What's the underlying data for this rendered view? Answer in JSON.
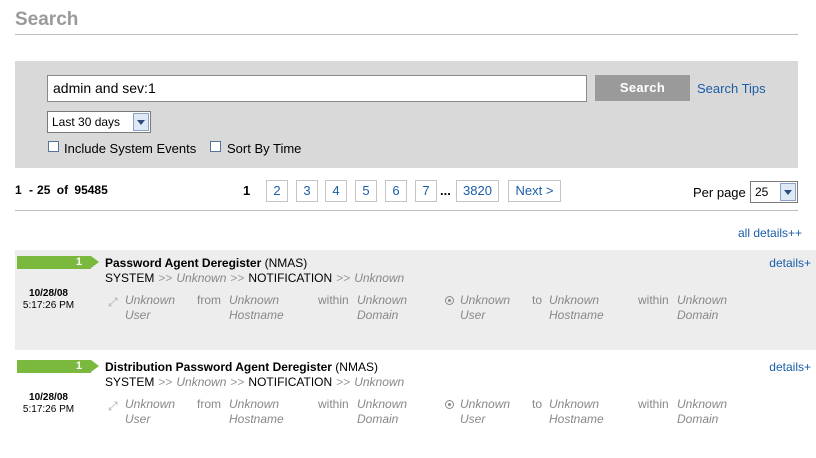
{
  "page_title": "Search",
  "search": {
    "query": "admin and sev:1",
    "button_label": "Search",
    "tips_label": "Search Tips",
    "range_selected": "Last 30 days",
    "include_system_label": "Include System Events",
    "sort_by_time_label": "Sort By Time"
  },
  "results": {
    "range_start": "1",
    "range_end": "25",
    "of_label": "of",
    "total": "95485",
    "dash": "-"
  },
  "pagination": {
    "current": "1",
    "pages": [
      "2",
      "3",
      "4",
      "5",
      "6",
      "7"
    ],
    "ellipsis": "...",
    "last": "3820",
    "next_label": "Next >"
  },
  "per_page": {
    "label": "Per page",
    "value": "25"
  },
  "all_details_label": "all details++",
  "events": [
    {
      "severity": "1",
      "name": "Password Agent Deregister",
      "source": "(NMAS)",
      "details_label": "details+",
      "taxonomy": [
        "SYSTEM",
        "Unknown",
        "NOTIFICATION",
        "Unknown"
      ],
      "sep": ">>",
      "date": "10/28/08",
      "time": "5:17:26 PM",
      "init_user": "Unknown User",
      "from_label": "from",
      "init_host": "Unknown Hostname",
      "within_label": "within",
      "init_domain": "Unknown Domain",
      "target_user": "Unknown User",
      "to_label": "to",
      "target_host": "Unknown Hostname",
      "target_within_label": "within",
      "target_domain": "Unknown Domain"
    },
    {
      "severity": "1",
      "name": "Distribution Password Agent Deregister",
      "source": "(NMAS)",
      "details_label": "details+",
      "taxonomy": [
        "SYSTEM",
        "Unknown",
        "NOTIFICATION",
        "Unknown"
      ],
      "sep": ">>",
      "date": "10/28/08",
      "time": "5:17:26 PM",
      "init_user": "Unknown User",
      "from_label": "from",
      "init_host": "Unknown Hostname",
      "within_label": "within",
      "init_domain": "Unknown Domain",
      "target_user": "Unknown User",
      "to_label": "to",
      "target_host": "Unknown Hostname",
      "target_within_label": "within",
      "target_domain": "Unknown Domain"
    }
  ]
}
